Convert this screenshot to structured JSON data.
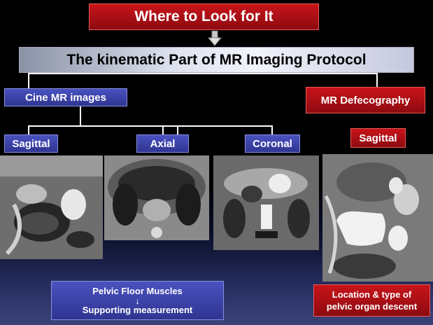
{
  "header": {
    "title": "Where to  Look for It"
  },
  "protocol": {
    "label": "The kinematic Part of MR Imaging Protocol"
  },
  "branches": {
    "cine": "Cine MR images",
    "defecography": "MR Defecography"
  },
  "planes": {
    "sagittal_1": "Sagittal",
    "axial": "Axial",
    "coronal": "Coronal",
    "sagittal_2": "Sagittal"
  },
  "outcomes": {
    "pelvic_floor_line1": "Pelvic Floor Muscles",
    "pelvic_floor_arrow": "↓",
    "pelvic_floor_line2": "Supporting measurement",
    "location_line1": "Location & type of",
    "location_line2": "pelvic organ descent"
  },
  "colors": {
    "red_box": "#b01015",
    "blue_box": "#3a42a8",
    "background": "#000000"
  }
}
